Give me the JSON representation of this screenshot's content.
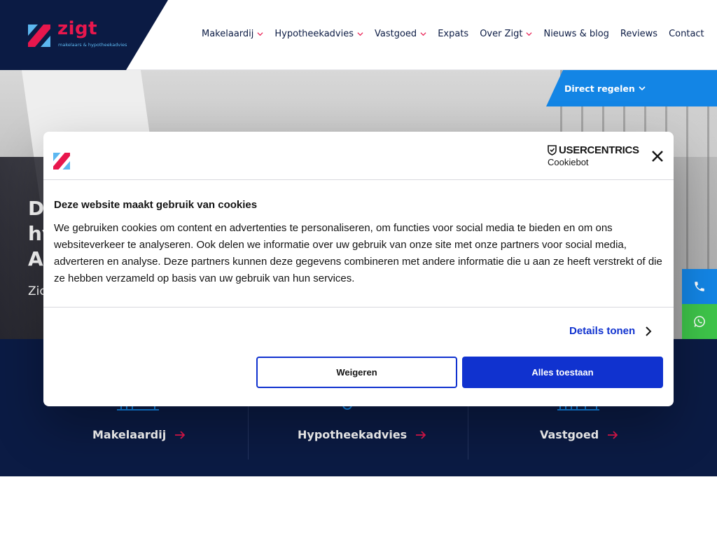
{
  "brand": {
    "name": "zigt",
    "tagline": "makelaars & hypotheekadvies",
    "colors": {
      "navy": "#0b1b44",
      "pink": "#e8174d",
      "lightblue": "#5cb7f0",
      "blue": "#1385e5"
    }
  },
  "nav": {
    "items": [
      {
        "label": "Makelaardij",
        "dropdown": true
      },
      {
        "label": "Hypotheekadvies",
        "dropdown": true
      },
      {
        "label": "Vastgoed",
        "dropdown": true
      },
      {
        "label": "Expats",
        "dropdown": false
      },
      {
        "label": "Over Zigt",
        "dropdown": true
      },
      {
        "label": "Nieuws & blog",
        "dropdown": false
      },
      {
        "label": "Reviews",
        "dropdown": false
      },
      {
        "label": "Contact",
        "dropdown": false
      }
    ]
  },
  "direct": {
    "label": "Direct regelen"
  },
  "hero": {
    "line1": "De",
    "line2": "hy",
    "line3": "Am",
    "sub": "Zic"
  },
  "side": {
    "phone_icon": "phone-icon",
    "whatsapp_icon": "whatsapp-icon"
  },
  "services": {
    "items": [
      {
        "label": "Makelaardij"
      },
      {
        "label": "Hypotheekadvies"
      },
      {
        "label": "Vastgoed"
      }
    ]
  },
  "cookie": {
    "brand_top": "USERCENTRICS",
    "brand_bottom": "Cookiebot",
    "title": "Deze website maakt gebruik van cookies",
    "body": "We gebruiken cookies om content en advertenties te personaliseren, om functies voor social media te bieden en om ons websiteverkeer te analyseren. Ook delen we informatie over uw gebruik van onze site met onze partners voor social media, adverteren en analyse. Deze partners kunnen deze gegevens combineren met andere informatie die u aan ze heeft verstrekt of die ze hebben verzameld op basis van uw gebruik van hun services.",
    "details_label": "Details tonen",
    "deny_label": "Weigeren",
    "allow_label": "Alles toestaan",
    "accent": "#1032cf"
  }
}
